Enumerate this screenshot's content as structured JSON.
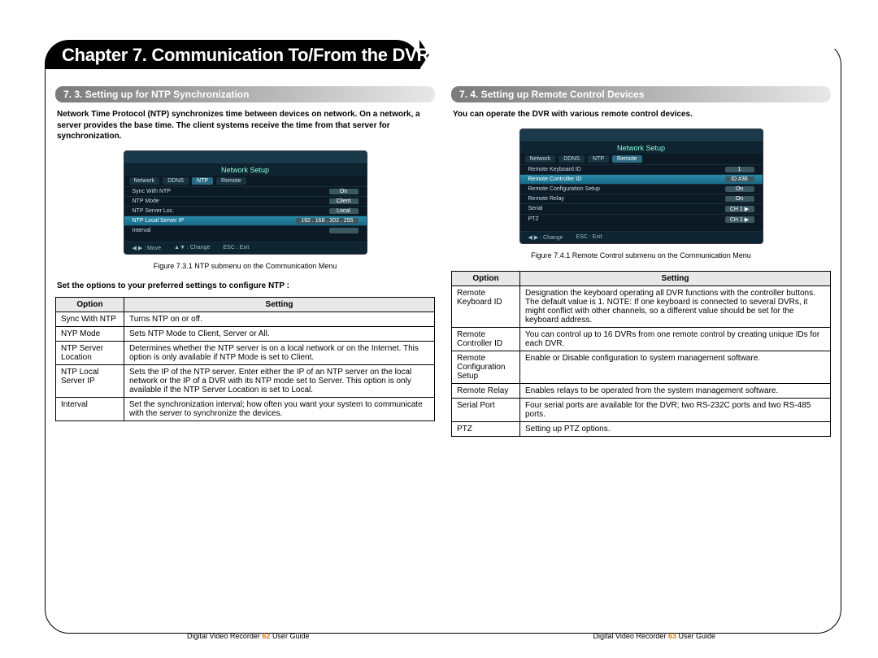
{
  "chapter_title": "Chapter 7. Communication To/From the DVR",
  "left": {
    "section_title": "7. 3. Setting up for NTP Synchronization",
    "intro": "Network Time Protocol (NTP) synchronizes time between devices on network. On a network, a server provides the base time. The client systems receive the time from that server for synchronization.",
    "screenshot": {
      "header": "Network Setup",
      "tabs": [
        "Network",
        "DDNS",
        "NTP",
        "Remote"
      ],
      "active_tab": 2,
      "rows": [
        {
          "label": "Sync With NTP",
          "value": "On"
        },
        {
          "label": "NTP Mode",
          "value": "Client"
        },
        {
          "label": "NTP Server Loc.",
          "value": "Local"
        },
        {
          "label": "NTP Local Server IP",
          "value": "192 . 168 . 202 . 255",
          "hl": true
        },
        {
          "label": "Interval",
          "value": ""
        }
      ],
      "footer": [
        "◀ ▶ : Move",
        "▲▼ : Change",
        "ESC : Exit"
      ]
    },
    "caption": "Figure 7.3.1 NTP submenu on the Communication Menu",
    "subhead": "Set the options to your preferred settings to configure NTP :",
    "table_head": {
      "option": "Option",
      "setting": "Setting"
    },
    "table": [
      {
        "option": "Sync With NTP",
        "setting": "Turns NTP on or off."
      },
      {
        "option": "NYP Mode",
        "setting": "Sets NTP Mode to Client, Server or All."
      },
      {
        "option": "NTP Server Location",
        "setting": "Determines whether the NTP server is on a local network or on the Internet. This option is only available if NTP Mode is set to Client."
      },
      {
        "option": "NTP Local Server IP",
        "setting": "Sets the IP of the NTP server. Enter either the IP of an NTP server on the local network or the IP of a DVR with its NTP mode set to Server.\nThis option is only available if the NTP Server Location is set to Local."
      },
      {
        "option": "Interval",
        "setting": "Set the synchronization interval; how often you want your system to communicate with the server to synchronize the devices."
      }
    ]
  },
  "right": {
    "section_title": "7. 4. Setting up Remote Control Devices",
    "intro": "You can operate the DVR with various remote control devices.",
    "screenshot": {
      "header": "Network Setup",
      "tabs": [
        "Network",
        "DDNS",
        "NTP",
        "Remote"
      ],
      "active_tab": 3,
      "rows": [
        {
          "label": "Remote Keyboard ID",
          "value": "1"
        },
        {
          "label": "Remote Controller ID",
          "value": "ID #36",
          "hl": true
        },
        {
          "label": "Remote Configuration Setup",
          "value": "On"
        },
        {
          "label": "Remote Relay",
          "value": "On"
        },
        {
          "label": "Serial",
          "value": "CH 1 ▶"
        },
        {
          "label": "PTZ",
          "value": "CH 1 ▶"
        }
      ],
      "footer": [
        "◀ ▶ : Change",
        "ESC : Exit"
      ]
    },
    "caption": "Figure 7.4.1 Remote Control submenu on the Communication Menu",
    "table_head": {
      "option": "Option",
      "setting": "Setting"
    },
    "table": [
      {
        "option": "Remote Keyboard ID",
        "setting": "Designation the keyboard operating all DVR functions with the controller buttons. The default value is 1.\nNOTE: If one keyboard is connected to several DVRs, it might conflict with other channels, so a different value should be set for the keyboard address."
      },
      {
        "option": "Remote Controller ID",
        "setting": "You can control up to 16 DVRs from one remote control by creating unique IDs for each DVR."
      },
      {
        "option": "Remote Configuration Setup",
        "setting": "Enable or Disable configuration to system management software."
      },
      {
        "option": "Remote Relay",
        "setting": "Enables relays to be operated from the system management software."
      },
      {
        "option": "Serial Port",
        "setting": "Four serial ports are available for the DVR; two RS-232C ports and two RS-485 ports."
      },
      {
        "option": "PTZ",
        "setting": "Setting up PTZ options."
      }
    ]
  },
  "footers": {
    "prefix": "Digital Video Recorder",
    "left_page": "62",
    "right_page": "63",
    "suffix": "User Guide"
  }
}
